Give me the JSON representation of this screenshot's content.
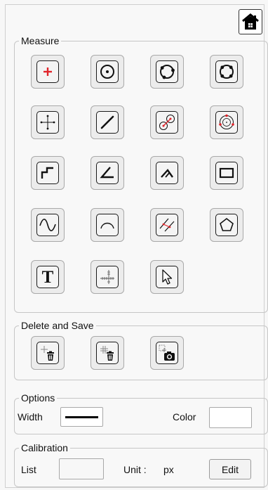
{
  "colors": {
    "accent_red": "#e0242a",
    "border": "#c6c6c6",
    "icon_dark": "#1a1a1a"
  },
  "home": {
    "icon": "home-icon"
  },
  "measure": {
    "title": "Measure",
    "tools": [
      "point-icon",
      "circle-center-icon",
      "circle-3point-icon",
      "circle-4point-icon",
      "crosshair-icon",
      "line-icon",
      "circle-distance-icon",
      "circle-fit-icon",
      "step-icon",
      "angle-icon",
      "angle-3point-icon",
      "rectangle-icon",
      "sine-curve-icon",
      "arc-icon",
      "parallel-lines-icon",
      "polygon-icon",
      "text-icon",
      "ruler-icon",
      "cursor-icon"
    ],
    "text_tool_glyph": "T"
  },
  "delete_save": {
    "title": "Delete and Save",
    "tools": [
      "delete-last-icon",
      "delete-all-icon",
      "screenshot-icon"
    ]
  },
  "options": {
    "title": "Options",
    "width_label": "Width",
    "color_label": "Color",
    "color_value": "#ffffff"
  },
  "calibration": {
    "title": "Calibration",
    "list_label": "List",
    "list_value": "",
    "unit_label": "Unit :",
    "unit_value": "px",
    "edit_label": "Edit"
  }
}
